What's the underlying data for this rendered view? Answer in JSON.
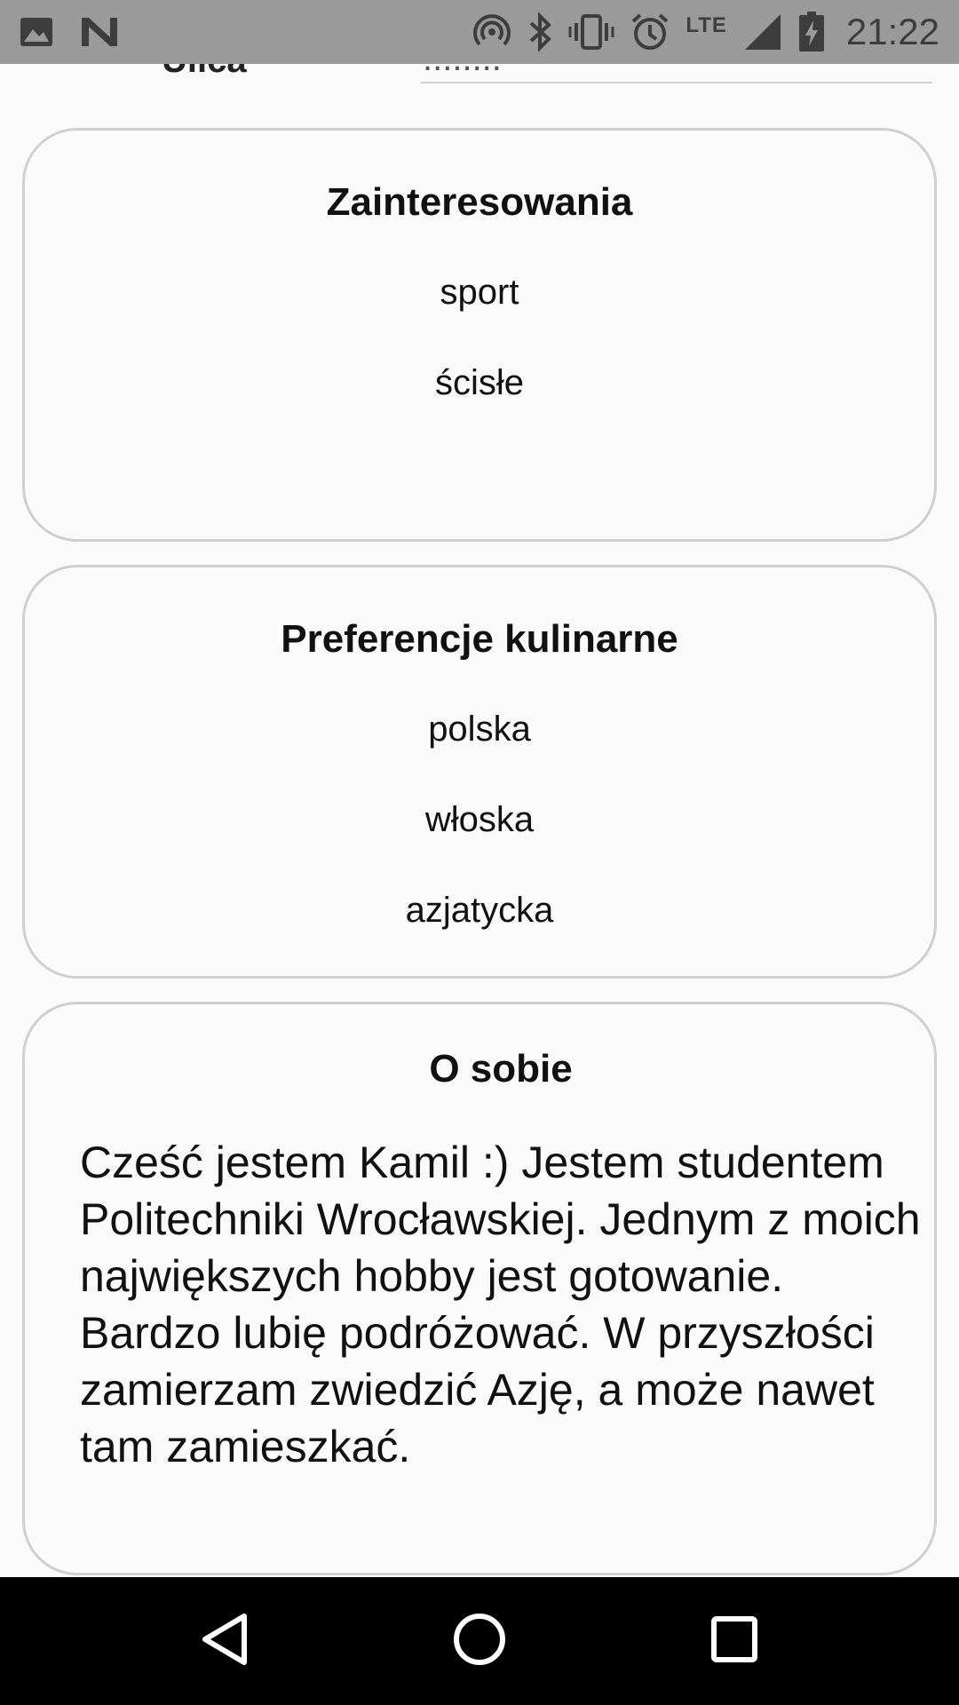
{
  "status_bar": {
    "time": "21:22",
    "network": "LTE",
    "icons": [
      "image-icon",
      "n-icon",
      "hotspot-icon",
      "bluetooth-icon",
      "vibrate-icon",
      "alarm-icon",
      "signal-icon",
      "battery-charging-icon"
    ]
  },
  "previous_field": {
    "label": "Ulica",
    "value": "........"
  },
  "interests": {
    "title": "Zainteresowania",
    "items": [
      "sport",
      "ścisłe"
    ]
  },
  "food": {
    "title": "Preferencje kulinarne",
    "items": [
      "polska",
      "włoska",
      "azjatycka"
    ]
  },
  "about": {
    "title": "O sobie",
    "text": "Cześć jestem Kamil :) Jestem studentem Politechniki Wrocławskiej. Jednym z moich największych hobby jest gotowanie. Bardzo lubię podróżować. W przyszłości zamierzam zwiedzić Azję, a może nawet tam zamieszkać."
  },
  "nav": [
    "back-icon",
    "home-icon",
    "recents-icon"
  ]
}
